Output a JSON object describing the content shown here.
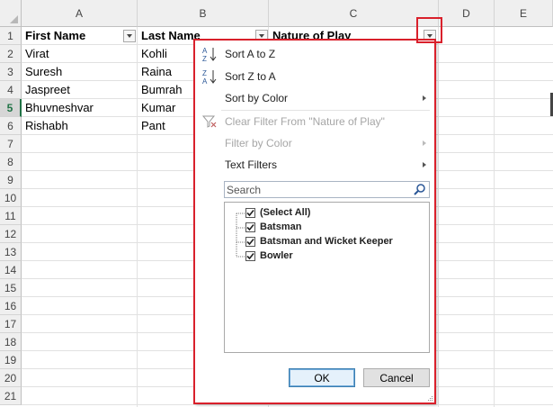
{
  "sheet": {
    "columns": [
      "A",
      "B",
      "C",
      "D",
      "E"
    ],
    "rows": [
      "1",
      "2",
      "3",
      "4",
      "5",
      "6",
      "7",
      "8",
      "9",
      "10",
      "11",
      "12",
      "13",
      "14",
      "15",
      "16",
      "17",
      "18",
      "19",
      "20",
      "21"
    ],
    "active_row": "5",
    "headers": {
      "first_name": "First Name",
      "last_name": "Last Name",
      "nature_of_play": "Nature of Play"
    },
    "data": [
      {
        "first": "Virat",
        "last": "Kohli"
      },
      {
        "first": "Suresh",
        "last": "Raina"
      },
      {
        "first": "Jaspreet",
        "last": "Bumrah"
      },
      {
        "first": "Bhuvneshvar",
        "last": "Kumar"
      },
      {
        "first": "Rishabh",
        "last": "Pant"
      }
    ],
    "highlight_color": "#d9202b"
  },
  "filter_menu": {
    "sort_az": "Sort A to Z",
    "sort_za": "Sort Z to A",
    "sort_by_color": "Sort by Color",
    "clear_filter": "Clear Filter From \"Nature of Play\"",
    "filter_by_color": "Filter by Color",
    "text_filters": "Text Filters",
    "search_placeholder": "Search",
    "items": [
      {
        "label": "(Select All)",
        "checked": true
      },
      {
        "label": "Batsman",
        "checked": true
      },
      {
        "label": "Batsman and Wicket Keeper",
        "checked": true
      },
      {
        "label": "Bowler",
        "checked": true
      }
    ],
    "ok_label": "OK",
    "cancel_label": "Cancel"
  }
}
